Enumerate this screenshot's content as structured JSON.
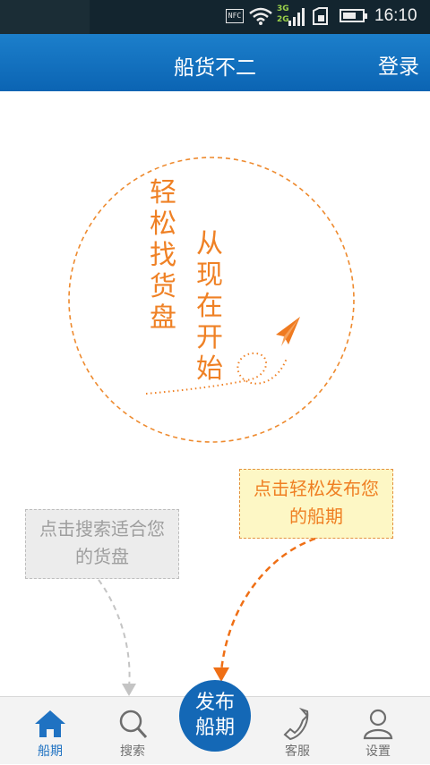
{
  "status_bar": {
    "nfc_label": "NFC",
    "network_3g": "3G",
    "network_2g": "2G",
    "time": "16:10",
    "battery_level": 0.7,
    "icons": [
      "nfc-icon",
      "wifi-icon",
      "signal-icon",
      "sim-card-icon",
      "battery-icon"
    ]
  },
  "header": {
    "title": "船货不二",
    "login_label": "登录"
  },
  "hero": {
    "line_1": "轻松找货盘",
    "line_2": "从现在开始",
    "icons": [
      "paper-plane-icon"
    ]
  },
  "hints": {
    "publish": "点击轻松发布您的船期",
    "search": "点击搜索适合您的货盘"
  },
  "tab_bar": {
    "items": [
      {
        "label": "船期",
        "icon": "home-icon",
        "active": true
      },
      {
        "label": "搜索",
        "icon": "search-icon",
        "active": false
      },
      {
        "label": "发布船期",
        "icon": "publish-button",
        "active": false
      },
      {
        "label": "客服",
        "icon": "phone-icon",
        "active": false
      },
      {
        "label": "设置",
        "icon": "user-icon",
        "active": false
      }
    ],
    "publish_line_1": "发布",
    "publish_line_2": "船期"
  },
  "colors": {
    "header_blue": "#0b64b3",
    "accent_orange": "#ef8125",
    "active_tab": "#1f72c2",
    "fab_blue": "#1468b6"
  }
}
